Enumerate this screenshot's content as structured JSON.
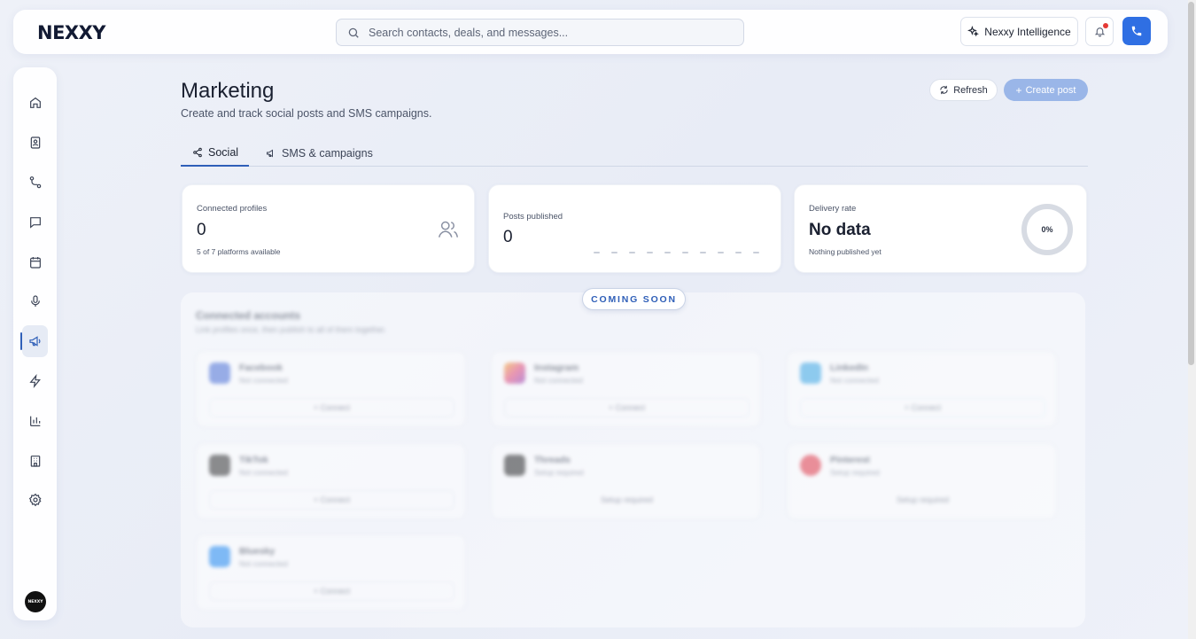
{
  "app": {
    "logo": "NEXXY"
  },
  "topbar": {
    "search_placeholder": "Search contacts, deals, and messages...",
    "ai_button": "Nexxy Intelligence"
  },
  "sidebar": {
    "items": [
      {
        "icon": "home-icon",
        "active": false
      },
      {
        "icon": "contacts-icon",
        "active": false
      },
      {
        "icon": "pipeline-icon",
        "active": false
      },
      {
        "icon": "chat-icon",
        "active": false
      },
      {
        "icon": "calendar-icon",
        "active": false
      },
      {
        "icon": "microphone-icon",
        "active": false
      },
      {
        "icon": "megaphone-icon",
        "active": true
      },
      {
        "icon": "lightning-icon",
        "active": false
      },
      {
        "icon": "bar-chart-icon",
        "active": false
      },
      {
        "icon": "building-icon",
        "active": false
      },
      {
        "icon": "gear-icon",
        "active": false
      }
    ],
    "avatar_text": "NEXXY"
  },
  "header": {
    "title": "Marketing",
    "subtitle": "Create and track social posts and SMS campaigns.",
    "refresh": "Refresh",
    "create": "Create post"
  },
  "tabs": [
    {
      "label": "Social",
      "active": true
    },
    {
      "label": "SMS & campaigns",
      "active": false
    }
  ],
  "stats": {
    "connected": {
      "label": "Connected profiles",
      "value": "0",
      "sub": "5 of 7 platforms available"
    },
    "published": {
      "label": "Posts published",
      "value": "0"
    },
    "delivery": {
      "label": "Delivery rate",
      "value": "No data",
      "sub": "Nothing published yet",
      "ring": "0%"
    }
  },
  "coming_soon": {
    "badge": "COMING SOON",
    "title": "Connected accounts",
    "desc": "Link profiles once, then publish to all of them together.",
    "accounts": [
      {
        "name": "Facebook",
        "status": "Not connected",
        "action": "+ Connect",
        "color": "#4b6fd6"
      },
      {
        "name": "Instagram",
        "status": "Not connected",
        "action": "+ Connect",
        "color": "#e0487a"
      },
      {
        "name": "LinkedIn",
        "status": "Not connected",
        "action": "+ Connect",
        "color": "#3aa6e4"
      },
      {
        "name": "TikTok",
        "status": "Not connected",
        "action": "+ Connect",
        "color": "#333333"
      },
      {
        "name": "Threads",
        "status": "Setup required",
        "action": "Setup required",
        "color": "#2a2a2a"
      },
      {
        "name": "Pinterest",
        "status": "Setup required",
        "action": "Setup required",
        "color": "#e03a4a"
      },
      {
        "name": "Bluesky",
        "status": "Not connected",
        "action": "+ Connect",
        "color": "#1e88f0"
      }
    ]
  },
  "colors": {
    "accent": "#2f6fe3",
    "active_nav": "#2f5fb8"
  }
}
